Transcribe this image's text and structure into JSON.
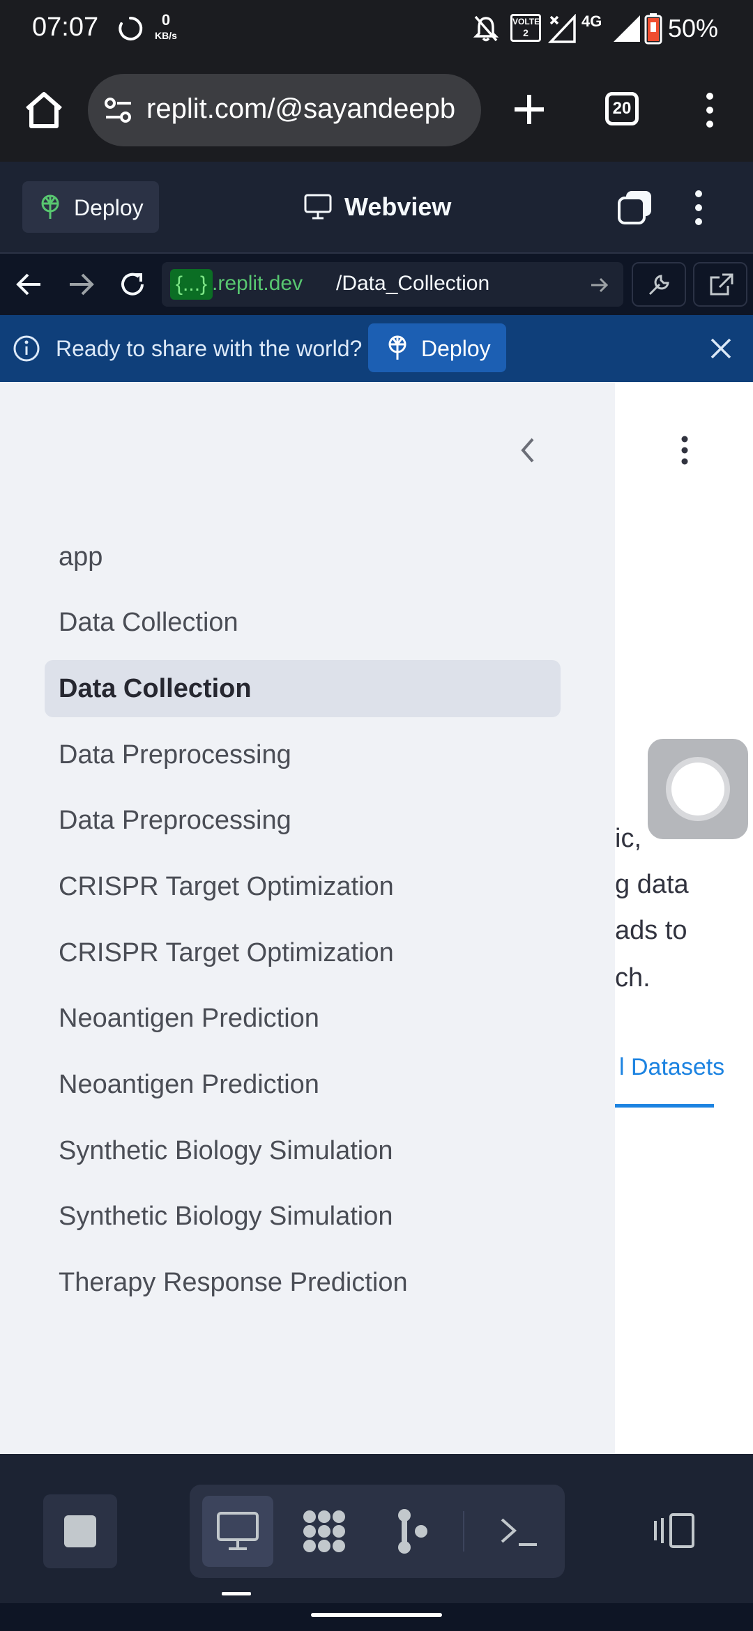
{
  "status_bar": {
    "time": "07:07",
    "net_speed_value": "0",
    "net_speed_unit": "KB/s",
    "network": "4G",
    "volte": "VOLTE",
    "battery": "50%"
  },
  "browser": {
    "url": "replit.com/@sayandeepb",
    "tab_count": "20"
  },
  "replit_header": {
    "deploy_label": "Deploy",
    "title": "Webview"
  },
  "webview_nav": {
    "url_chip": "{...}",
    "domain": ".replit.dev",
    "path": "/Data_Collection"
  },
  "banner": {
    "message": "Ready to share with the world?",
    "button_label": "Deploy"
  },
  "sidebar": {
    "items": [
      {
        "label": "app"
      },
      {
        "label": "Data Collection"
      },
      {
        "label": "Data Collection"
      },
      {
        "label": "Data Preprocessing"
      },
      {
        "label": "Data Preprocessing"
      },
      {
        "label": "CRISPR Target Optimization"
      },
      {
        "label": "CRISPR Target Optimization"
      },
      {
        "label": "Neoantigen Prediction"
      },
      {
        "label": "Neoantigen Prediction"
      },
      {
        "label": "Synthetic Biology Simulation"
      },
      {
        "label": "Synthetic Biology Simulation"
      },
      {
        "label": "Therapy Response Prediction"
      }
    ],
    "active_index": 2
  },
  "main": {
    "fragments": [
      "ic,",
      "g data",
      "ads to",
      "ch."
    ],
    "tab_label": "l Datasets"
  },
  "colors": {
    "accent_blue": "#1c83e1",
    "replit_bg": "#1c2333",
    "banner_bg": "#0f3f7a"
  }
}
